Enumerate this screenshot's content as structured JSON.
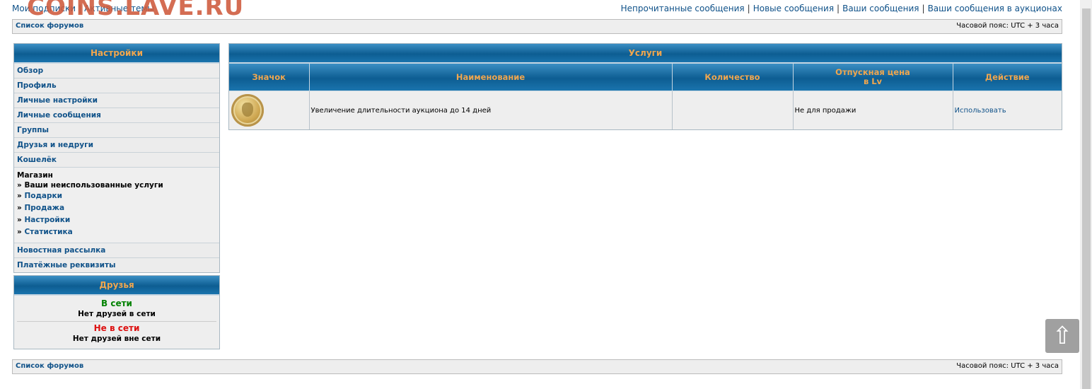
{
  "top": {
    "left_links": [
      "Мои подписки",
      "Активные темы"
    ],
    "right_links": [
      "Непрочитанные сообщения",
      "Новые сообщения",
      "Ваши сообщения",
      "Ваши сообщения в аукционах"
    ],
    "watermark": "COINS.LAVE.RU"
  },
  "nav": {
    "forum_list": "Список форумов",
    "timezone": "Часовой пояс: UTC + 3 часа"
  },
  "settings": {
    "title": "Настройки",
    "items": [
      "Обзор",
      "Профиль",
      "Личные настройки",
      "Личные сообщения",
      "Группы",
      "Друзья и недруги",
      "Кошелёк"
    ],
    "shop": {
      "title": "Магазин",
      "current": "» Ваши неиспользованные услуги",
      "arrow": "» ",
      "subitems": [
        "Подарки",
        "Продажа",
        "Настройки",
        "Статистика"
      ]
    },
    "bottom_items": [
      "Новостная рассылка",
      "Платёжные реквизиты"
    ]
  },
  "friends": {
    "title": "Друзья",
    "online_label": "В сети",
    "online_text": "Нет друзей в сети",
    "offline_label": "Не в сети",
    "offline_text": "Нет друзей вне сети"
  },
  "services": {
    "title": "Услуги",
    "columns": [
      "Значок",
      "Наименование",
      "Количество",
      "Отпускная цена",
      "в Lv",
      "Действие"
    ],
    "rows": [
      {
        "icon": "gold-coin-emblem-icon",
        "name": "Увеличение длительности аукциона до 14 дней",
        "quantity": "",
        "price": "Не для продажи",
        "action": "Использовать"
      }
    ]
  },
  "scroll_top": "⇧"
}
